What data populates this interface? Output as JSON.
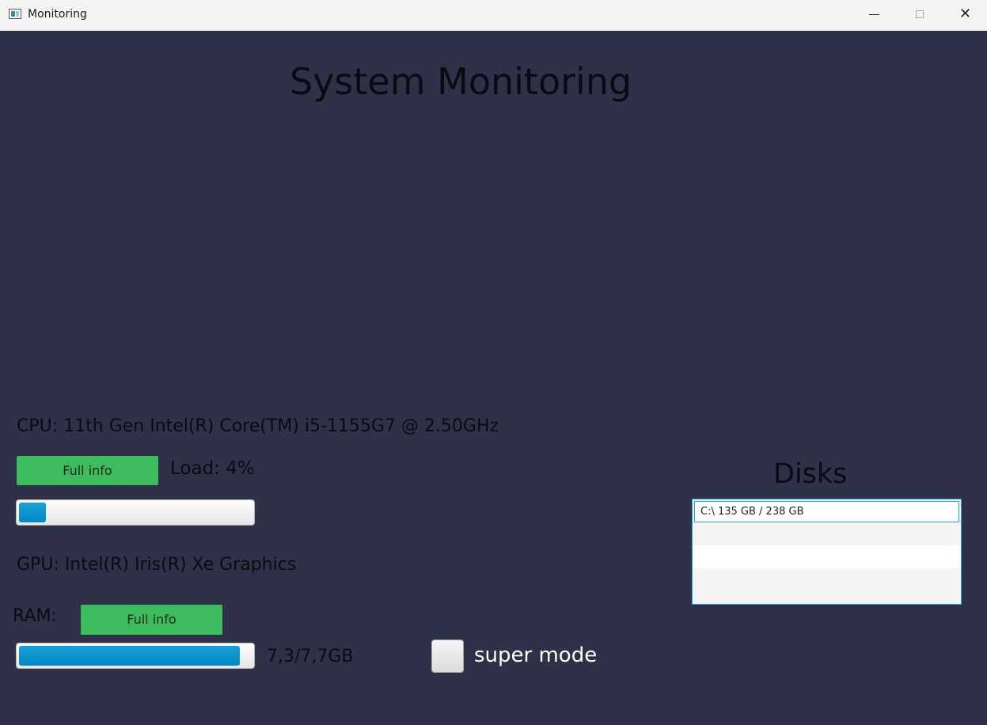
{
  "window": {
    "title": "Monitoring",
    "controls": [
      "minimize-icon",
      "maximize-icon",
      "close-icon"
    ]
  },
  "page": {
    "title": "System Monitoring"
  },
  "cpu": {
    "label": "CPU: 11th Gen Intel(R) Core(TM) i5-1155G7 @ 2.50GHz",
    "button_label": "Full info",
    "load_label": "Load: 4%",
    "load_fraction": 0.04
  },
  "gpu": {
    "label": "GPU: Intel(R) Iris(R) Xe Graphics"
  },
  "ram": {
    "label": "RAM:",
    "button_label": "Full info",
    "value_label": "7,3/7,7GB",
    "used_fraction": 0.948
  },
  "super_mode": {
    "label": "super mode",
    "checked": false
  },
  "disks": {
    "title": "Disks",
    "items": [
      "C:\\ 135 GB / 238 GB",
      "",
      "",
      ""
    ]
  },
  "colors": {
    "background": "#2f3149",
    "button": "#3cbc5c",
    "progress_fill": "#0090c8",
    "selection_border": "#1e9fd6"
  }
}
